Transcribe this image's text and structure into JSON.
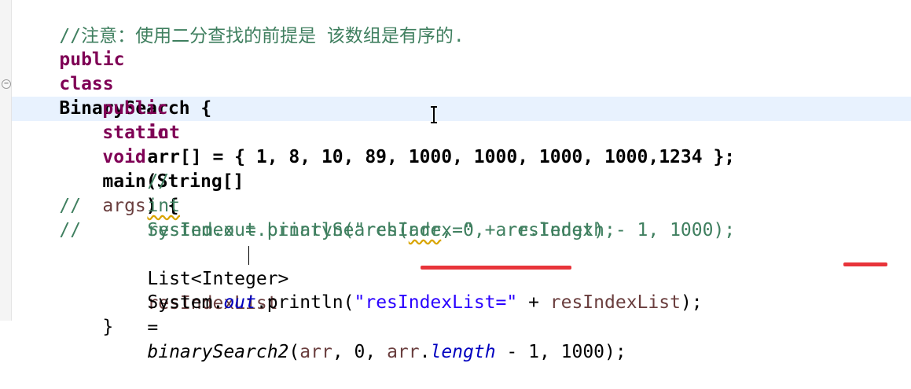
{
  "editor": {
    "lines": [
      {
        "comment": "//注意：使用二分查找的前提是 该数组是有序的."
      },
      {
        "kw1": "public",
        "kw2": "class",
        "name": "BinarySearch {"
      },
      {},
      {
        "kw1": "public",
        "kw2": "static",
        "kw3": "void",
        "rest": "main(String[]",
        "args": "args",
        "end": ") {"
      },
      {
        "kw": "int",
        "rest": "arr[] = { 1, 8, 10, 89, 1000, 1000, 1000, 1000,1234 };"
      },
      {},
      {
        "comment": "//"
      },
      {
        "prefix": "//",
        "kw": "int",
        "rest1": "resIndex = binarySearch(",
        "arr": "arr",
        "rest2": ", 0, arr.length - 1, 1000);"
      },
      {
        "prefix": "//",
        "rest": "System.out.println(\"resIndex=\" + resIndex);"
      },
      {},
      {
        "type": "List<Integer>",
        "var": "resIndexList",
        "eq": "=",
        "method": "binarySearch2",
        "args1": "(",
        "arr": "arr",
        "args2": ", 0, ",
        "arr2": "arr",
        "dot": ".",
        "field": "length",
        "args3": " - 1, 1000);"
      },
      {
        "sys": "System.",
        "out": "out",
        "println": ".println(",
        "str": "\"resIndexList=\"",
        "plus": " + ",
        "var": "resIndexList",
        "end": ");"
      },
      {
        "brace": "}"
      }
    ]
  },
  "colors": {
    "keyword": "#7f0055",
    "comment": "#3f7f5f",
    "string": "#2a00ff",
    "field": "#0000c0",
    "annotation_red": "#e8343a",
    "current_line": "#e8f2fe"
  }
}
